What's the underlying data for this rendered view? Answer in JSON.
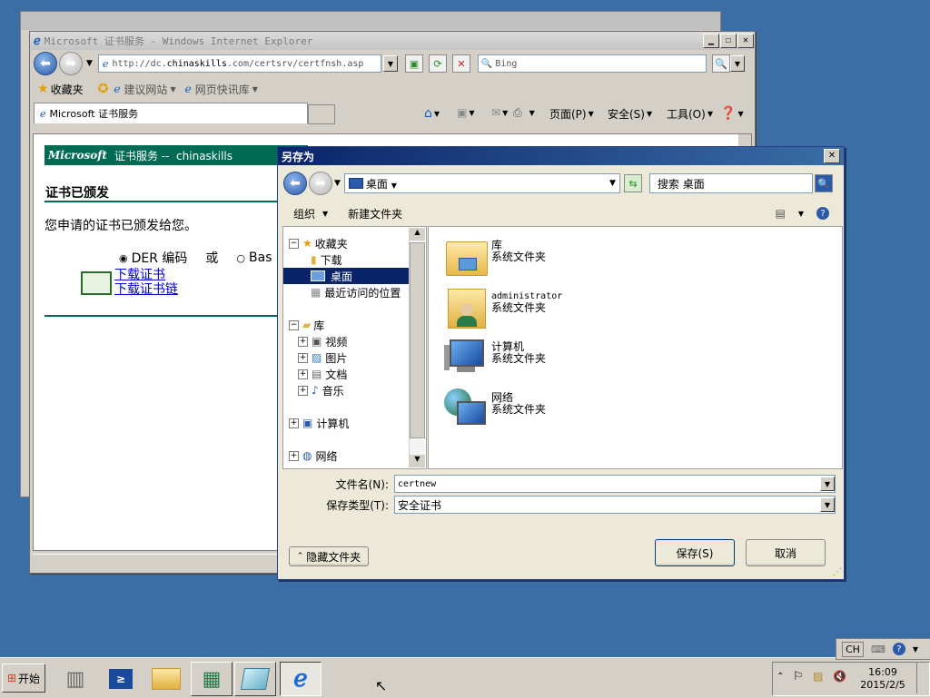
{
  "ie": {
    "title": "Microsoft 证书服务 - Windows Internet Explorer",
    "address": "http://dc.chinaskills.com/certsrv/certfnsh.asp",
    "address_prefix": "http://dc.",
    "address_domain": "chinaskills",
    "address_suffix": ".com/certsrv/certfnsh.asp",
    "search_placeholder": "Bing",
    "favorites_label": "收藏夹",
    "suggested_sites": "建议网站",
    "web_slices": "网页快讯库",
    "tab_title": "Microsoft 证书服务",
    "cmd": {
      "page": "页面(P)",
      "safety": "安全(S)",
      "tools": "工具(O)"
    }
  },
  "page": {
    "header_brand": "Microsoft",
    "header_text": "证书服务 --  chinaskills",
    "heading": "证书已颁发",
    "message": "您申请的证书已颁发给您。",
    "der_label": "DER 编码",
    "or_label": "或",
    "base64_label": "Bas",
    "download_cert": "下载证书",
    "download_chain": "下载证书链"
  },
  "dialog": {
    "title": "另存为",
    "location": "桌面",
    "search_placeholder": "搜索 桌面",
    "organize": "组织",
    "new_folder": "新建文件夹",
    "nav": {
      "favorites": "收藏夹",
      "downloads": "下载",
      "desktop": "桌面",
      "recent": "最近访问的位置",
      "libraries": "库",
      "videos": "视频",
      "pictures": "图片",
      "documents": "文档",
      "music": "音乐",
      "computer": "计算机",
      "network": "网络"
    },
    "files": [
      {
        "name": "库",
        "type": "系统文件夹"
      },
      {
        "name": "administrator",
        "type": "系统文件夹"
      },
      {
        "name": "计算机",
        "type": "系统文件夹"
      },
      {
        "name": "网络",
        "type": "系统文件夹"
      }
    ],
    "filename_label": "文件名(N):",
    "filename_value": "certnew",
    "filetype_label": "保存类型(T):",
    "filetype_value": "安全证书",
    "hide_folders": "隐藏文件夹",
    "save": "保存(S)",
    "cancel": "取消"
  },
  "taskbar": {
    "start": "开始",
    "lang": "CH",
    "time": "16:09",
    "date": "2015/2/5"
  },
  "colors": {
    "desktop": "#3a6ea5",
    "cert_header": "#006a52",
    "selection": "#0a246a"
  }
}
